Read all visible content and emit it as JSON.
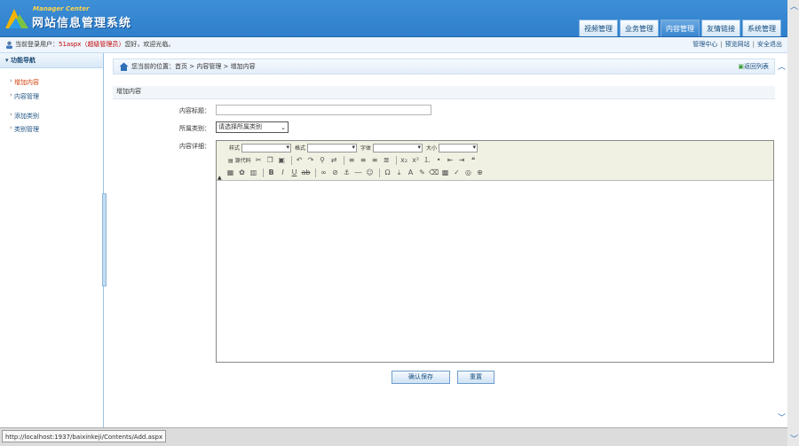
{
  "app": {
    "brand_en": "Manager Center",
    "brand_cn": "网站信息管理系统"
  },
  "nav_tabs": [
    {
      "label": "视频管理"
    },
    {
      "label": "业务管理"
    },
    {
      "label": "内容管理",
      "active": true
    },
    {
      "label": "友情链接"
    },
    {
      "label": "系统管理"
    }
  ],
  "userbar": {
    "prefix": "当前登录用户：",
    "username": "51aspx",
    "role_open": "（",
    "role": "超级管理员",
    "role_close": "）",
    "greeting": "您好，欢迎光临。",
    "links": [
      "管理中心",
      "预览网站",
      "安全退出"
    ],
    "sep": "|"
  },
  "sidebar": {
    "title": "功能导航",
    "items": [
      {
        "label": "增加内容",
        "active": true
      },
      {
        "label": "内容管理"
      },
      {
        "label": "添加类别"
      },
      {
        "label": "类别管理"
      }
    ]
  },
  "breadcrumb": {
    "text": "您当前的位置：首页 > 内容管理 > 增加内容",
    "back": "返回列表"
  },
  "section_title": "增加内容",
  "form": {
    "title_label": "内容标题：",
    "title_value": "",
    "category_label": "所属类别：",
    "category_value": "请选择所属类别",
    "detail_label": "内容详细："
  },
  "editor": {
    "style_label": "样式",
    "format_label": "格式",
    "font_label": "字体",
    "size_label": "大小",
    "source_label": "源代码"
  },
  "buttons": {
    "save": "确认保存",
    "reset": "重置"
  },
  "statusbar": {
    "url": "http://localhost:1937/baixinkeji/Contents/Add.aspx"
  },
  "colors": {
    "header": "#3d8fd6",
    "active_tab": "#3a86cf",
    "accent_red": "#c00000"
  },
  "icons": [
    "logo-icon",
    "user-icon",
    "home-icon",
    "back-icon",
    "scroll-up-icon",
    "scroll-down-icon"
  ]
}
